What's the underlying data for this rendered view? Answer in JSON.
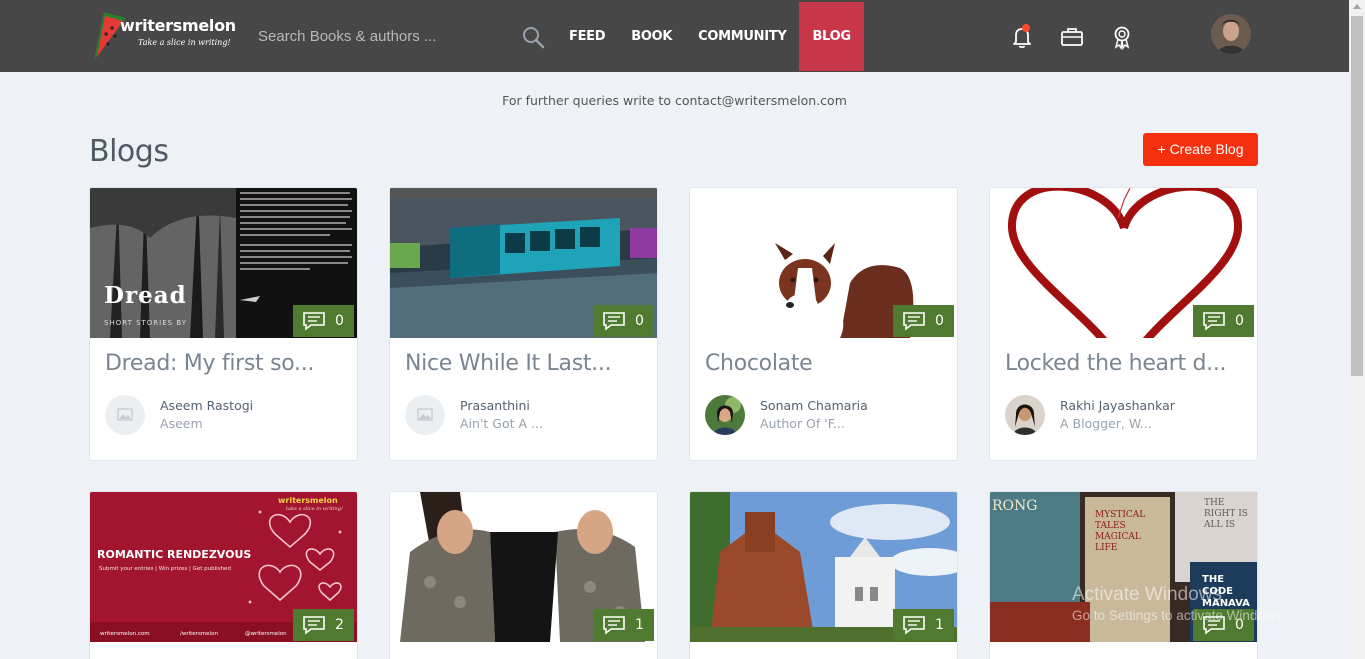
{
  "header": {
    "logo_text": "writersmelon",
    "logo_tagline": "Take a slice in writing!",
    "search_placeholder": "Search Books & authors ...",
    "nav": [
      {
        "label": "FEED",
        "active": false
      },
      {
        "label": "BOOK",
        "active": false
      },
      {
        "label": "COMMUNITY",
        "active": false
      },
      {
        "label": "BLOG",
        "active": true
      }
    ],
    "icons": [
      "bell-icon",
      "briefcase-icon",
      "award-icon"
    ],
    "accent_color": "#c8364a"
  },
  "notice": "For further queries write to contact@writersmelon.com",
  "page_title": "Blogs",
  "create_button": "+ Create Blog",
  "blogs": [
    {
      "title": "Dread: My first so...",
      "comments": "0",
      "author": "Aseem Rastogi",
      "bio": "Aseem",
      "img_text": "Dread",
      "img_sub": "SHORT STORIES BY"
    },
    {
      "title": "Nice While It Last...",
      "comments": "0",
      "author": "Prasanthini",
      "bio": "Ain't Got A ..."
    },
    {
      "title": "Chocolate",
      "comments": "0",
      "author": "Sonam Chamaria",
      "bio": "Author Of 'F..."
    },
    {
      "title": "Locked the heart d...",
      "comments": "0",
      "author": "Rakhi Jayashankar",
      "bio": "A Blogger, W..."
    },
    {
      "title": "",
      "comments": "2",
      "author": "",
      "bio": "",
      "img_brand": "writersmelon",
      "img_brand_tag": "take a slice in writing!",
      "img_heading": "ROMANTIC RENDEZVOUS",
      "img_sub": "Submit your entries | Win prizes | Get published",
      "img_footer": [
        "writersmelon.com",
        "/writersmelon",
        "@writersmelon"
      ]
    },
    {
      "title": "",
      "comments": "1",
      "author": "",
      "bio": ""
    },
    {
      "title": "",
      "comments": "1",
      "author": "",
      "bio": ""
    },
    {
      "title": "",
      "comments": "0",
      "author": "",
      "bio": "",
      "img_books": [
        "RONG",
        "MYSTICAL TALES MAGICAL LIFE",
        "THE RIGHT IS ALL IS",
        "THE CODE MANAVA"
      ]
    }
  ],
  "watermark": {
    "title": "Activate Windows",
    "subtitle": "Go to Settings to activate Windows."
  }
}
